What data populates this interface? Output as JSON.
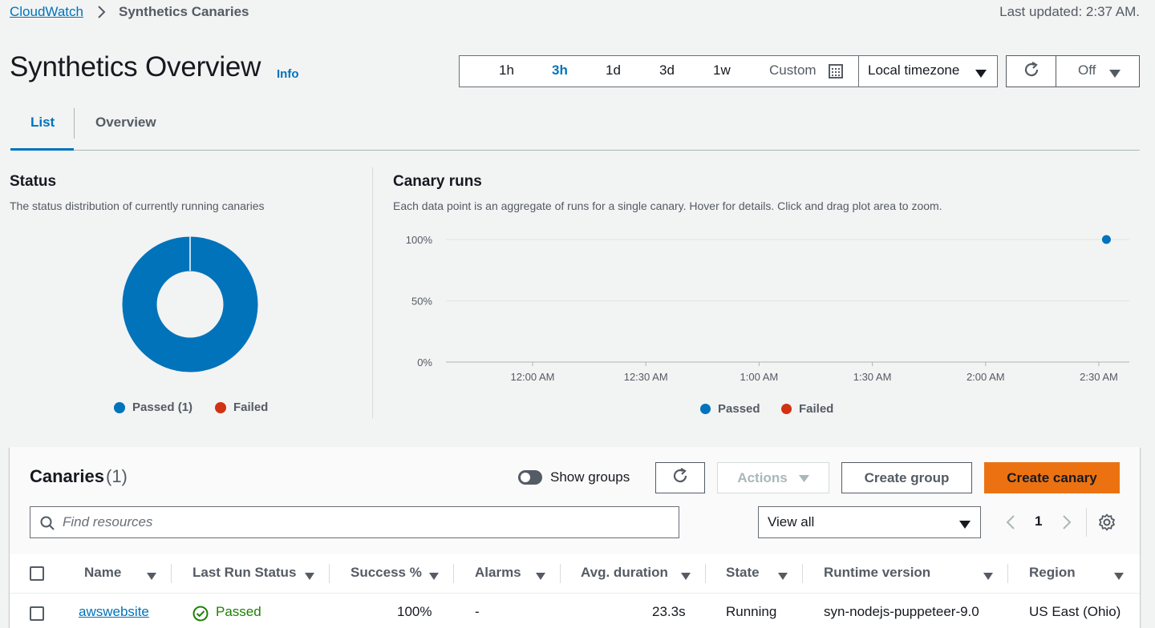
{
  "breadcrumb": {
    "parent": "CloudWatch",
    "current": "Synthetics Canaries"
  },
  "last_updated": "Last updated: 2:37 AM.",
  "page": {
    "title": "Synthetics Overview",
    "info": "Info"
  },
  "time_range": {
    "options": [
      "1h",
      "3h",
      "1d",
      "3d",
      "1w"
    ],
    "selected": "3h",
    "custom": "Custom",
    "timezone": "Local timezone",
    "auto_refresh": "Off"
  },
  "tabs": [
    {
      "label": "List",
      "active": true
    },
    {
      "label": "Overview",
      "active": false
    }
  ],
  "status_panel": {
    "title": "Status",
    "description": "The status distribution of currently running canaries",
    "legend": {
      "passed": "Passed (1)",
      "failed": "Failed"
    },
    "passed_count": 1,
    "failed_count": 0
  },
  "canary_runs": {
    "title": "Canary runs",
    "description": "Each data point is an aggregate of runs for a single canary. Hover for details. Click and drag plot area to zoom.",
    "legend": {
      "passed": "Passed",
      "failed": "Failed"
    }
  },
  "chart_data": {
    "type": "scatter",
    "y_ticks": [
      "100%",
      "50%",
      "0%"
    ],
    "ylim": [
      0,
      100
    ],
    "x_ticks": [
      "12:00 AM",
      "12:30 AM",
      "1:00 AM",
      "1:30 AM",
      "2:00 AM",
      "2:30 AM"
    ],
    "series": [
      {
        "name": "Passed",
        "color": "#0073bb",
        "points": [
          {
            "x": "2:32 AM",
            "y": 100
          }
        ]
      },
      {
        "name": "Failed",
        "color": "#d13212",
        "points": []
      }
    ]
  },
  "colors": {
    "passed": "#0073bb",
    "failed": "#d13212",
    "primary_button": "#ec7211",
    "link": "#0073bb"
  },
  "canaries": {
    "title": "Canaries",
    "count": "(1)",
    "show_groups_label": "Show groups",
    "actions_label": "Actions",
    "create_group_label": "Create group",
    "create_canary_label": "Create canary",
    "search_placeholder": "Find resources",
    "filter_selected": "View all",
    "current_page": "1",
    "columns": [
      "Name",
      "Last Run Status",
      "Success %",
      "Alarms",
      "Avg. duration",
      "State",
      "Runtime version",
      "Region"
    ],
    "rows": [
      {
        "name": "awswebsite",
        "last_run_status": "Passed",
        "success": "100%",
        "alarms": "-",
        "avg_duration": "23.3s",
        "state": "Running",
        "runtime_version": "syn-nodejs-puppeteer-9.0",
        "region": "US East (Ohio)"
      }
    ]
  },
  "icons": {
    "breadcrumb_separator": "chevron-right-icon",
    "calendar": "calendar-icon",
    "refresh": "refresh-icon",
    "search": "search-icon",
    "settings": "gear-icon",
    "status_passed": "check-circle-icon"
  }
}
